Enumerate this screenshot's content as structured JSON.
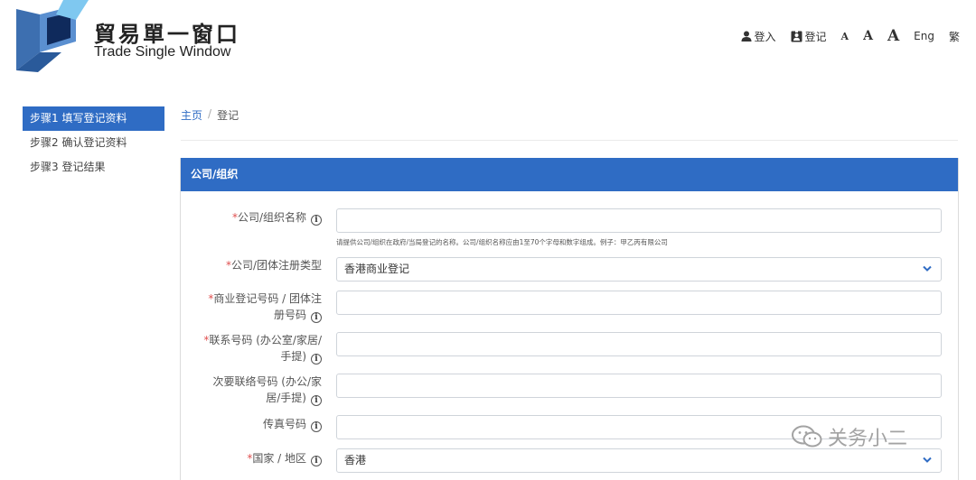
{
  "brand": {
    "name_zh": "貿易單一窗口",
    "name_en": "Trade Single Window"
  },
  "topbar": {
    "login": "登入",
    "register": "登记",
    "font_small": "A",
    "font_medium": "A",
    "font_large": "A",
    "lang_eng": "Eng",
    "lang_trad": "繁"
  },
  "sidebar": {
    "steps": [
      {
        "label": "步骤1 填写登记资料",
        "active": true
      },
      {
        "label": "步骤2 确认登记资料",
        "active": false
      },
      {
        "label": "步骤3 登记结果",
        "active": false
      }
    ]
  },
  "breadcrumb": {
    "home": "主页",
    "separator": "/",
    "current": "登记"
  },
  "panel": {
    "title": "公司/组织"
  },
  "form": {
    "company_name": {
      "label": "公司/组织名称",
      "value": "",
      "hint": "请提供公司/组织在政府/当局登记的名称。公司/组织名称应由1至70个字母和数字组成。例子：甲乙丙有限公司"
    },
    "reg_type": {
      "label": "公司/团体注册类型",
      "value": "香港商业登记"
    },
    "br_number": {
      "label_line1": "商业登记号码 / 团体注",
      "label_line2": "册号码",
      "value": ""
    },
    "phone": {
      "label_line1": "联系号码 (办公室/家居/",
      "label_line2": "手提)",
      "value": ""
    },
    "phone2": {
      "label_line1": "次要联络号码 (办公/家",
      "label_line2": "居/手提)",
      "value": ""
    },
    "fax": {
      "label": "传真号码",
      "value": ""
    },
    "country": {
      "label": "国家 / 地区",
      "value": "香港"
    },
    "required_mark": "*",
    "info_mark": "i"
  },
  "watermark": {
    "text": "关务小二"
  },
  "colors": {
    "accent": "#2f6cc4",
    "required": "#e05050"
  }
}
